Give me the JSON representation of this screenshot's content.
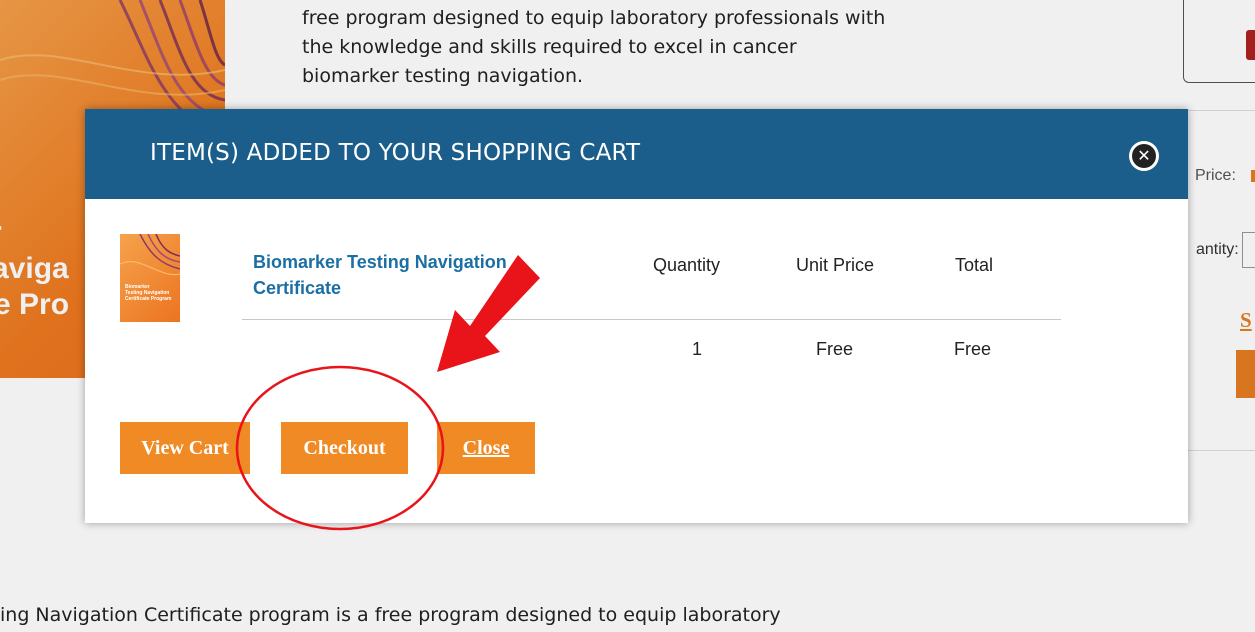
{
  "background": {
    "intro_lines": [
      "free program designed to equip laboratory professionals with",
      "the knowledge and skills required to excel in cancer",
      "biomarker testing navigation."
    ],
    "hero_lines": [
      "r",
      "aviga",
      "e Pro"
    ],
    "bottom_text": "ing Navigation Certificate program is a free program designed to equip laboratory",
    "price_label": "Price:",
    "quantity_label": "antity:",
    "side_link": "S"
  },
  "modal": {
    "title": "ITEM(S) ADDED TO YOUR SHOPPING CART",
    "close_icon": "close-circle-icon",
    "product": {
      "name_lines": [
        "Biomarker Testing Navigation",
        "Certificate"
      ],
      "thumbnail_text": [
        "Biomarker",
        "Testing Navigation",
        "Certificate Program"
      ]
    },
    "columns": {
      "quantity": "Quantity",
      "unit_price": "Unit Price",
      "total": "Total"
    },
    "row": {
      "quantity": "1",
      "unit_price": "Free",
      "total": "Free"
    },
    "buttons": {
      "view_cart": "View Cart",
      "checkout": "Checkout",
      "close": "Close"
    }
  },
  "annotations": {
    "color": "#e8141a",
    "arrow": "red-arrow",
    "highlight": "red-circle"
  },
  "colors": {
    "header_blue": "#1b5e8b",
    "button_orange": "#f08a24",
    "link_blue": "#1b6fa5",
    "brand_orange": "#ec7420"
  }
}
